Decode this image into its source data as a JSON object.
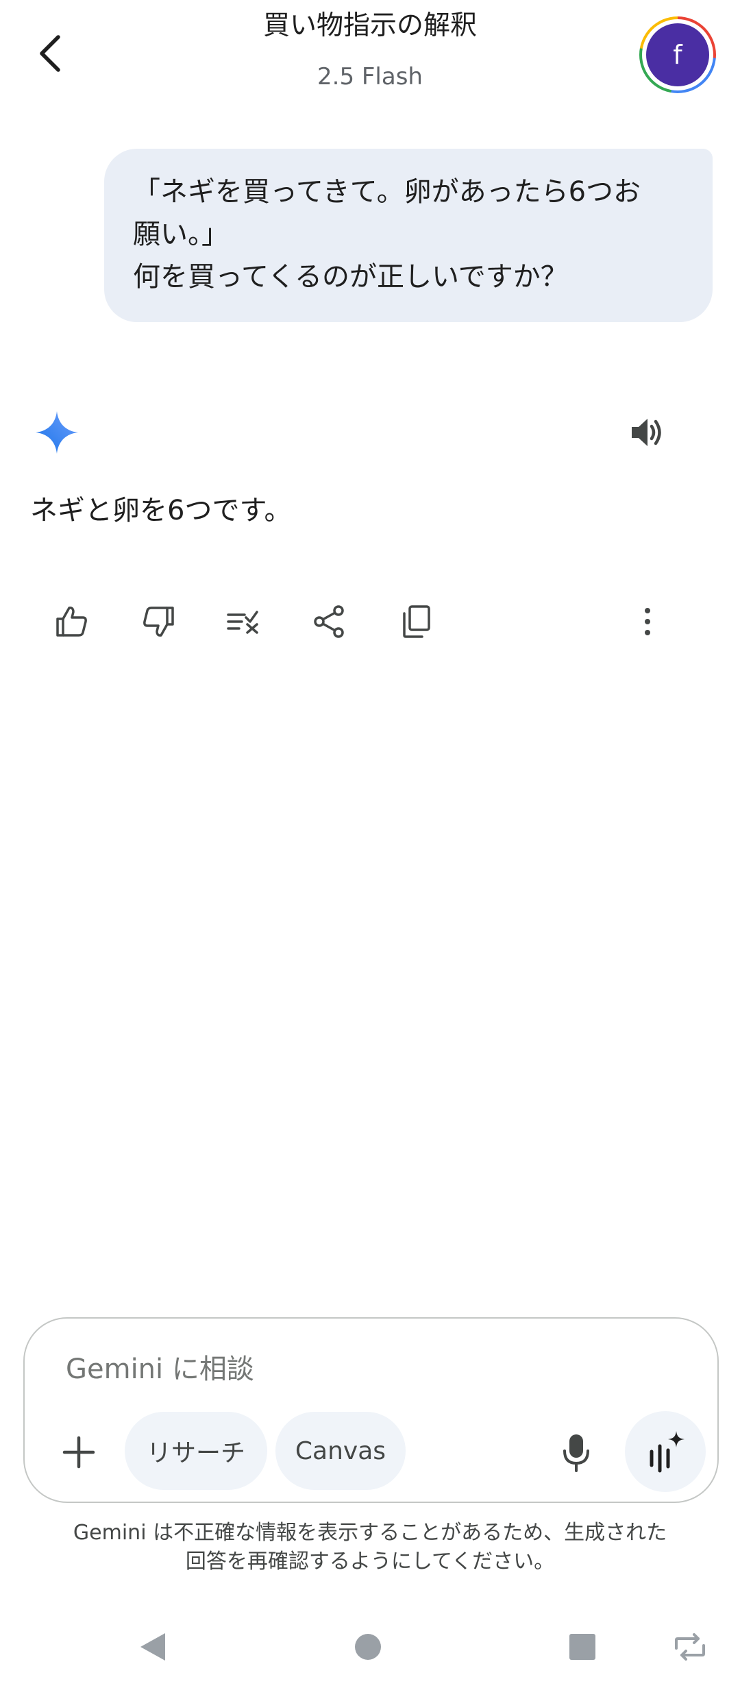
{
  "header": {
    "title": "買い物指示の解釈",
    "model": "2.5 Flash"
  },
  "avatar": {
    "initial": "f",
    "color": "#4a2ea3"
  },
  "user_message": {
    "text": "「ネギを買ってきて。卵があったら6つお\n願い。」\n何を買ってくるのが正しいですか？"
  },
  "response": {
    "text": "ネギと卵を6つです。"
  },
  "response_actions": {
    "icons": [
      "thumb-up-icon",
      "thumb-down-icon",
      "modify-response-icon",
      "share-icon",
      "copy-icon",
      "more-vert-icon",
      "speaker-icon"
    ]
  },
  "composer": {
    "placeholder": "Gemini に相談",
    "value": "",
    "chips": [
      "リサーチ",
      "Canvas"
    ]
  },
  "disclaimer": "Gemini は不正確な情報を表示することがあるため、生成された\n回答を再確認するようにしてください。",
  "colors": {
    "bubble_bg": "#e9eef6",
    "accent_blue": "#4285f4",
    "chip_bg": "#f0f4f9"
  }
}
